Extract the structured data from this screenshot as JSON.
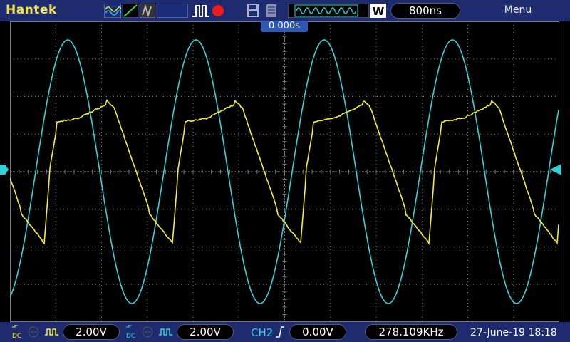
{
  "header": {
    "brand": "Hantek",
    "timebase": "800ns",
    "menu_label": "Menu",
    "trigger_time": "0.000s"
  },
  "footer": {
    "ch1": {
      "coupling": "DC",
      "scale": "2.00V"
    },
    "ch2": {
      "coupling": "DC",
      "scale": "2.00V"
    },
    "trigger": {
      "source": "CH2",
      "level": "0.00V"
    },
    "frequency": "278.109KHz",
    "datetime": "27-June-19 18:18"
  },
  "colors": {
    "ch1": "#f5ee2c",
    "ch2": "#2fd3d8",
    "bar": "#1e2b6e",
    "grid": "#7a7a7a"
  },
  "icons": [
    "wave-mode-icon",
    "persist-icon",
    "run-icon",
    "record-icon",
    "save-icon",
    "printer-icon",
    "waveform-memory-icon",
    "w-icon",
    "trigger-rise-icon"
  ]
}
